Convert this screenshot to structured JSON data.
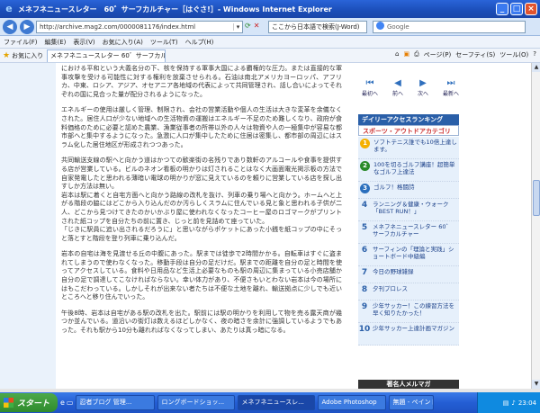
{
  "window": {
    "title": "メネフネニュースレター　60゛サーフカルチャー［はぐさ!］- Windows Internet Explorer"
  },
  "address": {
    "url": "http://archive.mag2.com/0000081176/index.html",
    "japanese_search": "ここから日本語で検索(J-Word)",
    "google_placeholder": "Google"
  },
  "menu": [
    "ファイル(F)",
    "編集(E)",
    "表示(V)",
    "お気に入り(A)",
    "ツール(T)",
    "ヘルプ(H)"
  ],
  "favbar": {
    "favorites": "お気に入り",
    "tab": "メネフネニュースレター 60゛サーフカルチャー［はぐさ!］",
    "commands": [
      "ページ(P)",
      "セーフティ(S)",
      "ツール(O)"
    ]
  },
  "article": {
    "paragraphs": [
      "における平和という大義名分の下、核を保持する軍事大国による覇権的な圧力。または直接的な軍事攻撃を受ける可能性に対する権利を放棄させられる。石油は南北アメリカヨーロッパ、アフリカ、中東、ロシア、アジア、オセアニア各地域の代表によって共同管理され、話し合いによってそれぞれの国に見合った量が配分されるようになった。",
      "エネルギーの使用は厳しく管理、制限され、会社の営業活動や個人の生活は大きな変革を余儀なくされた。居住人口が少ない地域への生活物資の運搬はエネルギー不足のため難しくなり、政府が食料価格のために必要と認めた農業、漁業従事者の所帯以外の人々は物資や人の一極集中が容易な都市部へと集中するようになった。急激に人口が集中したために住居は密集し、都市部の周辺にはスラム化した居住地区が形成されつつあった。",
      "共同輸送支線の駅へと向かう道はかつての歓楽街の名残りであり数軒のアルコールや食事を提供する店が営業している。ビルのネオン看板の明かりは灯されることはなく大画面電光掲示板の方法で自家発電したと思われる薄暗い電球の明かりが窓に見えているのを頼りに営業している店を探し出すしか方法は無い。",
      "岩本は駅に着くと自宅方面へと向かう路線の改札を抜け、列車の乗り場へと向かう。ホームへと上がる階段の脇にはどこから入り込んだのか汚らしくスラムに住んでいる見と象と思われる子供が二人、どこから見つけてきたのかいかぶり屋に使われなくなったコーヒー屋のロゴマークがプリントされた紙コップを自分たちの前に置き、じっと前を見詰めて座っていた。",
      "「じきに駅員に追い出されるだろうに」と思いながらポケットにあった小銭を紙コップの中にそっと落とすと階段を登り列車に乗り込んだ。",
      "岩本の自宅は海を見渡せる丘の中腹にあった。駅までは徒歩で2時間かかる。自転車はすぐに盗まれてしまうので使わなくなった。移動手段は自分の足だけだ。駅までの距離を自分の足と時間を使ってアクセスしている。食料や日用品など生活上必要なものも駅の周辺に集まっている小売店舗か自分の足で調達してこなければならない。幸い体力があり、不便さもいとわない岩本は今の場所にはもこだわっている。しかしそれが出来ない者たちは不便な土地を離れ、輸送拠点に少しでも近いところへと移り住んでいった。",
      "午後8時、岩本は自宅がある駅の改札を出た。駅前には駅の明かりを利用して物を売る露天商が幾つか並んでいる。道沿いの街灯は数えるほどしかなく、夜の暗さを余計に強調しているようでもあった。それも駅から10分も離れればなくなってしまい、あたりは真っ暗になる。"
    ]
  },
  "nav": {
    "first": "最初へ",
    "prev": "前へ",
    "next": "次へ",
    "last": "最新へ"
  },
  "ranking": {
    "header": "デイリーアクセスランキング",
    "subheader": "スポーツ・アウトドアカテゴリ",
    "items": [
      {
        "num": "1",
        "text": "ソフトテニス誰でも10倍上達します。"
      },
      {
        "num": "2",
        "text": "100を切るゴルフ講座！超簡単なゴルフ上達法"
      },
      {
        "num": "3",
        "text": "ゴルフ！格闘詩"
      },
      {
        "num": "4",
        "text": "ランニング＆健康・ウォーク「BEST RUN！」"
      },
      {
        "num": "5",
        "text": "メネフネニュースレター 60゛サーフカルチャー"
      },
      {
        "num": "6",
        "text": "サーフィンの「理論と実践」ショートボード中級編"
      },
      {
        "num": "7",
        "text": "今日の野球雑録"
      },
      {
        "num": "8",
        "text": "夕刊プロレス"
      },
      {
        "num": "9",
        "text": "少年サッカー！この練習方法を早く知りたかった！"
      },
      {
        "num": "10",
        "text": "少年サッカー上達計画マガジン"
      }
    ],
    "banner": "著名人メルマガ"
  },
  "taskbar": {
    "start": "スタート",
    "tasks": [
      "忍者ブログ 管理...",
      "ロングボードショッ...",
      "メネフネニュースレ...",
      "Adobe Photoshop",
      "無題 - ペイント"
    ],
    "clock": "23:04"
  },
  "colors": {
    "titlebar": "#1b4db8",
    "accent": "#2a5fa8",
    "rank_top": "#f5b000"
  }
}
